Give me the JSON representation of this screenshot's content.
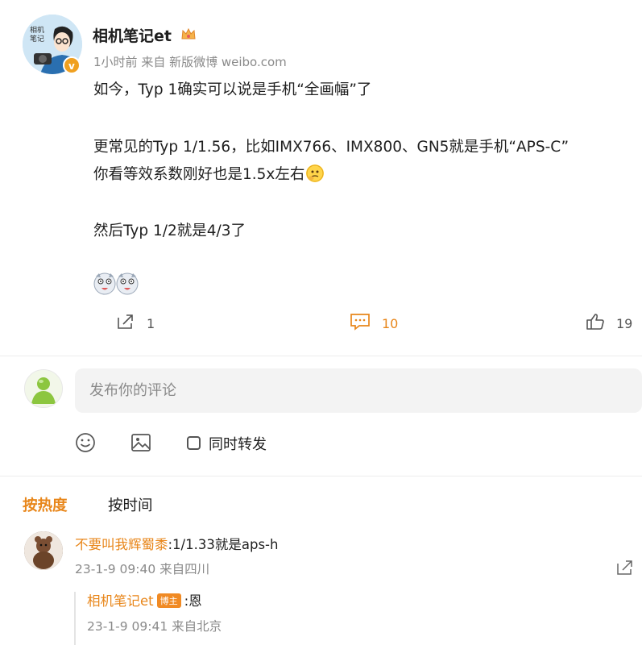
{
  "post": {
    "author": "相机笔记et",
    "time": "1小时前",
    "source": "来自 新版微博 weibo.com",
    "lines": [
      "如今，Typ 1确实可以说是手机“全画幅”了",
      "更常见的Typ 1/1.56，比如IMX766、IMX800、GN5就是手机“APS-C”",
      "你看等效系数刚好也是1.5x左右",
      "然后Typ 1/2就是4/3了"
    ],
    "actions": {
      "repost_count": "1",
      "comment_count": "10",
      "like_count": "19"
    }
  },
  "comment_box": {
    "placeholder": "发布你的评论",
    "repost_label": "同时转发"
  },
  "sort": {
    "hot": "按热度",
    "time": "按时间"
  },
  "comments": [
    {
      "user": "不要叫我辉蜀黍",
      "text": ":1/1.33就是aps-h",
      "meta": "23-1-9 09:40 来自四川",
      "reply": {
        "user": "相机笔记et",
        "badge": "博主",
        "text": ":恩",
        "meta": "23-1-9 09:41 来自北京"
      }
    }
  ],
  "colors": {
    "accent": "#e8861a",
    "meta_text": "#8a8a8a",
    "input_bg": "#f3f3f3"
  }
}
